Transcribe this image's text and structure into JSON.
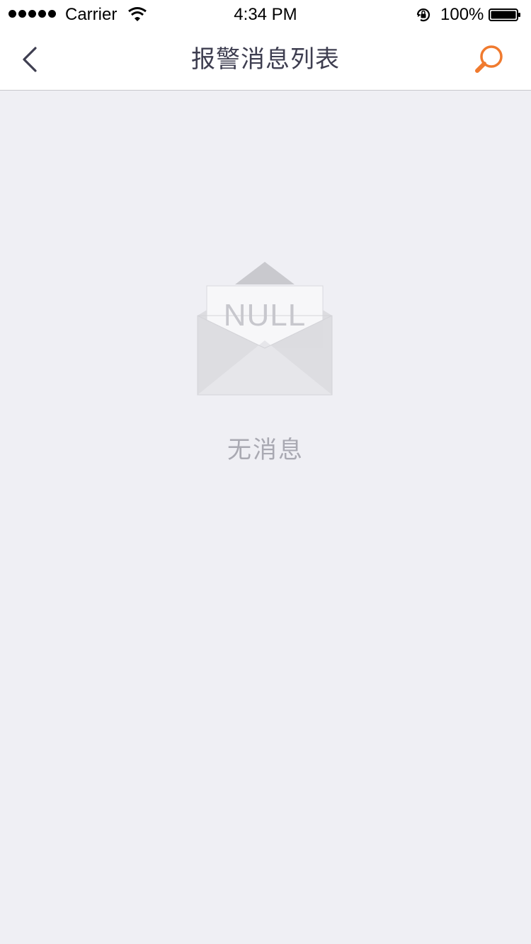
{
  "status_bar": {
    "carrier": "Carrier",
    "time": "4:34 PM",
    "battery": "100%",
    "icons": [
      "signal-dots",
      "wifi-icon",
      "rotation-lock-icon",
      "battery-icon"
    ]
  },
  "navbar": {
    "title": "报警消息列表",
    "back_icon": "chevron-left-icon",
    "search_icon": "search-icon",
    "accent_color": "#f07a2e",
    "title_color": "#3e3e50"
  },
  "empty_state": {
    "illustration_text": "NULL",
    "message": "无消息",
    "icon": "open-envelope-icon"
  },
  "colors": {
    "background": "#efeff4",
    "header": "#ffffff"
  }
}
